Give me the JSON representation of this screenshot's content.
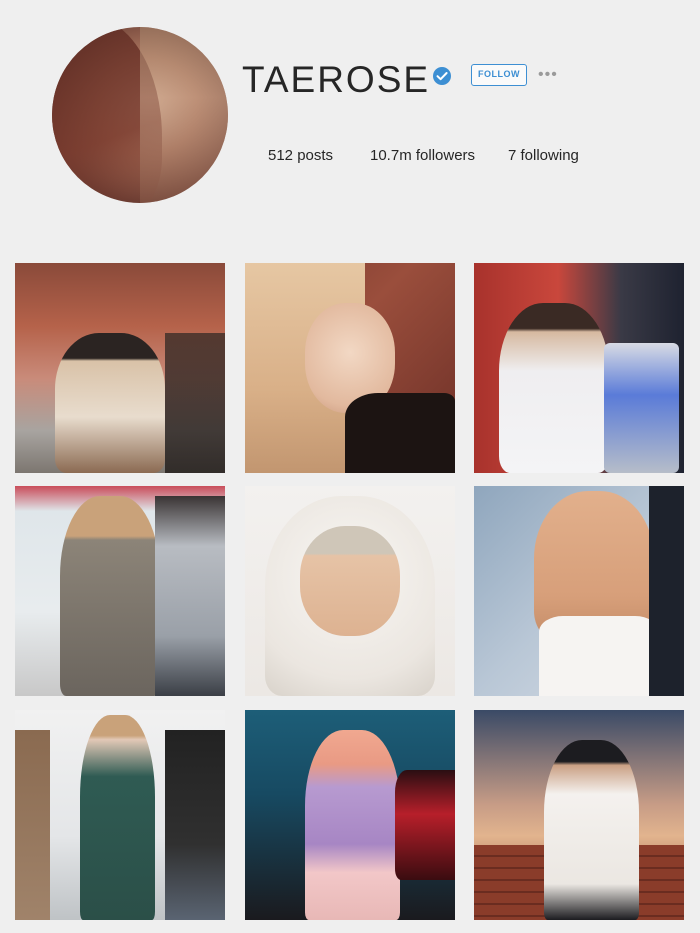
{
  "profile": {
    "username": "TAEROSE",
    "follow_label": "FOLLOW",
    "more_label": "•••",
    "posts": "512 posts",
    "followers": "10.7m followers",
    "following": "7 following"
  },
  "colors": {
    "accent": "#3d8fd3",
    "background": "#efefef",
    "text": "#262626"
  },
  "icons": {
    "verified": "verified-badge-icon",
    "more": "more-options-icon"
  },
  "posts": [
    {
      "description": "man in floral shirt on street"
    },
    {
      "description": "blonde woman portrait"
    },
    {
      "description": "man in white jacket near ATM"
    },
    {
      "description": "woman in long coat at airport"
    },
    {
      "description": "man wrapped in white blanket"
    },
    {
      "description": "woman with ponytail in white top"
    },
    {
      "description": "man in green coat and scarf"
    },
    {
      "description": "woman in lilac blouse by red car"
    },
    {
      "description": "man in white shirt and cap at dusk"
    }
  ]
}
